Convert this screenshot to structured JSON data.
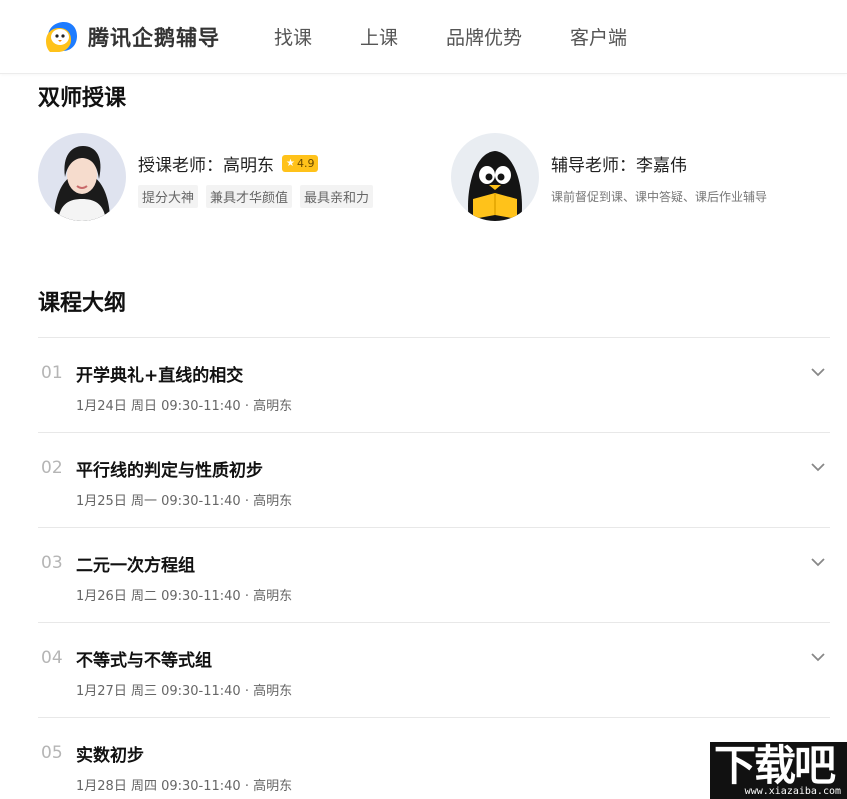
{
  "header": {
    "brand": "腾讯企鹅辅导",
    "nav": [
      "找课",
      "上课",
      "品牌优势",
      "客户端"
    ]
  },
  "teachers_section": {
    "title": "双师授课",
    "lecturer": {
      "name": "授课老师：高明东",
      "rating": "4.9",
      "tags": [
        "提分大神",
        "兼具才华颜值",
        "最具亲和力"
      ]
    },
    "tutor": {
      "name": "辅导老师：李嘉伟",
      "description": "课前督促到课、课中答疑、课后作业辅导"
    }
  },
  "outline": {
    "title": "课程大纲",
    "lessons": [
      {
        "num": "01",
        "title": "开学典礼+直线的相交",
        "meta": "1月24日 周日 09:30-11:40 · 高明东"
      },
      {
        "num": "02",
        "title": "平行线的判定与性质初步",
        "meta": "1月25日 周一 09:30-11:40 · 高明东"
      },
      {
        "num": "03",
        "title": "二元一次方程组",
        "meta": "1月26日 周二 09:30-11:40 · 高明东"
      },
      {
        "num": "04",
        "title": "不等式与不等式组",
        "meta": "1月27日 周三 09:30-11:40 · 高明东"
      },
      {
        "num": "05",
        "title": "实数初步",
        "meta": "1月28日 周四 09:30-11:40 · 高明东"
      }
    ]
  },
  "watermark": {
    "text": "下载吧",
    "url": "www.xiazaiba.com"
  },
  "colors": {
    "rating_badge": "#ffc21a",
    "tutor_book": "#ffc21a"
  }
}
